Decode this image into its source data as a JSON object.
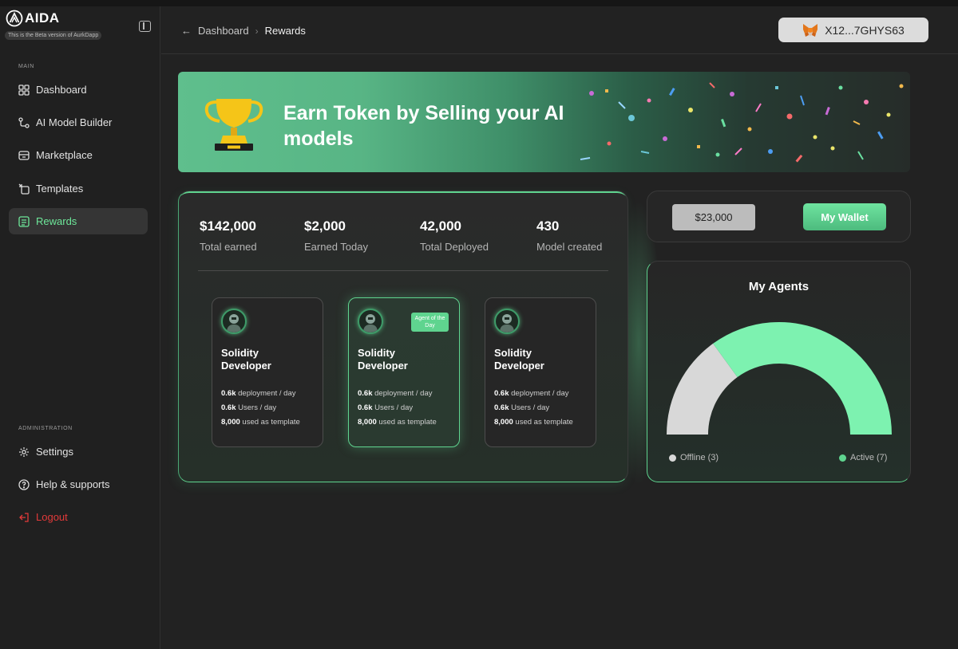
{
  "app": {
    "name": "AIDA",
    "beta_note": "This is the Beta version of AurkDapp"
  },
  "sidebar": {
    "main_label": "MAIN",
    "items": [
      {
        "label": "Dashboard",
        "icon": "grid-icon"
      },
      {
        "label": "AI Model Builder",
        "icon": "builder-icon"
      },
      {
        "label": "Marketplace",
        "icon": "store-icon"
      },
      {
        "label": "Templates",
        "icon": "template-icon"
      },
      {
        "label": "Rewards",
        "icon": "rewards-icon",
        "active": true
      }
    ],
    "admin_label": "ADMINISTRATION",
    "admin_items": [
      {
        "label": "Settings",
        "icon": "gear-icon"
      },
      {
        "label": "Help & supports",
        "icon": "help-icon"
      },
      {
        "label": "Logout",
        "icon": "logout-icon"
      }
    ]
  },
  "header": {
    "back_label": "Dashboard",
    "current_label": "Rewards",
    "wallet_address": "X12...7GHYS63"
  },
  "banner": {
    "title": "Earn Token by Selling your AI models"
  },
  "stats": [
    {
      "value": "$142,000",
      "label": "Total earned"
    },
    {
      "value": "$2,000",
      "label": "Earned Today"
    },
    {
      "value": "42,000",
      "label": "Total Deployed"
    },
    {
      "value": "430",
      "label": "Model created"
    }
  ],
  "agents": [
    {
      "title": "Solidity Developer",
      "deployments": "0.6k",
      "deployments_suffix": "deployment / day",
      "users": "0.6k",
      "users_suffix": "Users / day",
      "templates": "8,000",
      "templates_suffix": "used as template"
    },
    {
      "title": "Solidity Developer",
      "badge": "Agent of the Day",
      "deployments": "0.6k",
      "deployments_suffix": "deployment / day",
      "users": "0.6k",
      "users_suffix": "Users / day",
      "templates": "8,000",
      "templates_suffix": "used as template"
    },
    {
      "title": "Solidity Developer",
      "deployments": "0.6k",
      "deployments_suffix": "deployment / day",
      "users": "0.6k",
      "users_suffix": "Users / day",
      "templates": "8,000",
      "templates_suffix": "used as template"
    }
  ],
  "wallet": {
    "balance": "$23,000",
    "button_label": "My Wallet"
  },
  "my_agents": {
    "title": "My Agents",
    "offline_label": "Offline (3)",
    "active_label": "Active (7)",
    "offline_count": 3,
    "active_count": 7,
    "offline_color": "#d8d8d8",
    "active_color": "#7df2b0"
  },
  "colors": {
    "accent": "#5fd48f",
    "background": "#222222",
    "logout": "#e23a3a"
  }
}
